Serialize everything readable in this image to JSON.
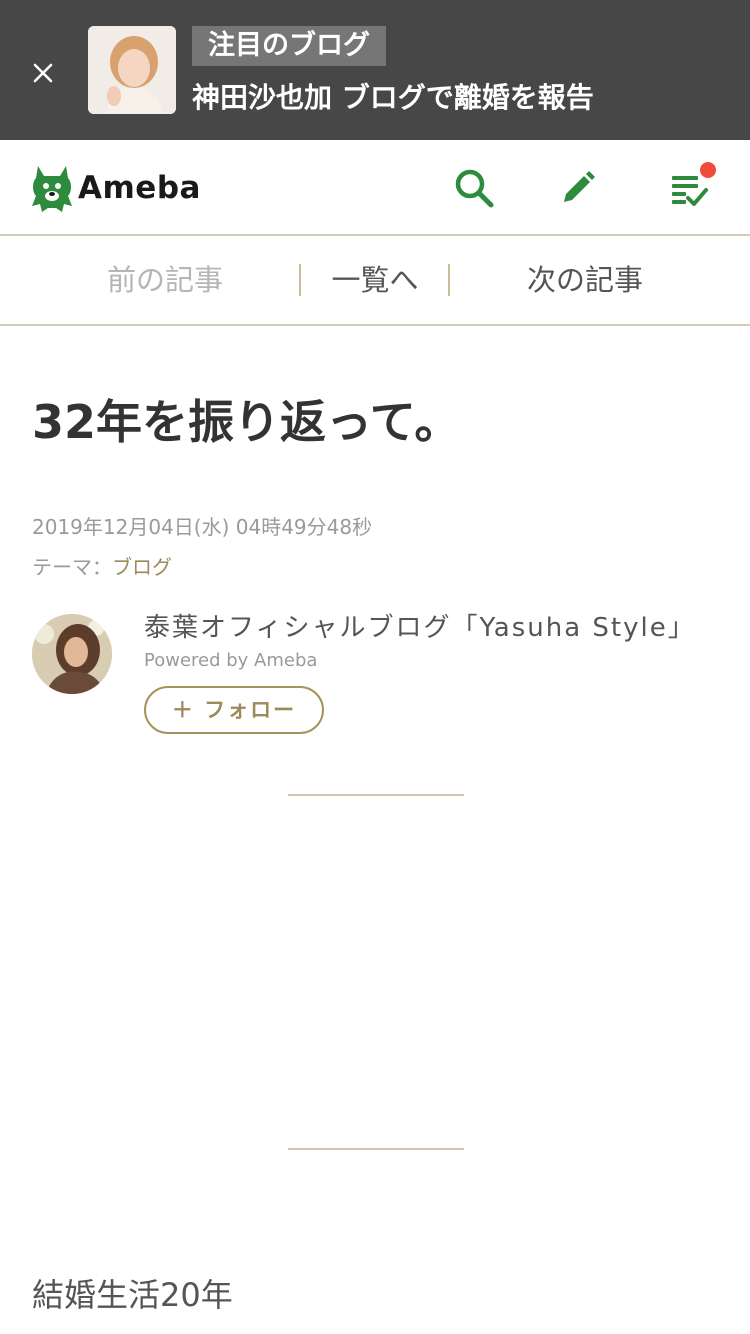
{
  "banner": {
    "tag": "注目のブログ",
    "headline": "神田沙也加 ブログで離婚を報告"
  },
  "header": {
    "logo_text": "Ameba",
    "notification_color": "#f04b3c",
    "accent_color": "#2e8b3e"
  },
  "article_nav": {
    "prev": "前の記事",
    "list": "一覧へ",
    "next": "次の記事"
  },
  "article": {
    "title": "32年を振り返って。",
    "date": "2019年12月04日(水) 04時49分48秒",
    "theme_label": "テーマ：",
    "theme": "ブログ",
    "body_first_line": "結婚生活20年"
  },
  "author": {
    "blog_name": "泰葉オフィシャルブログ「Yasuha Style」",
    "powered_by": "Powered by Ameba",
    "follow_label": "＋ フォロー"
  }
}
